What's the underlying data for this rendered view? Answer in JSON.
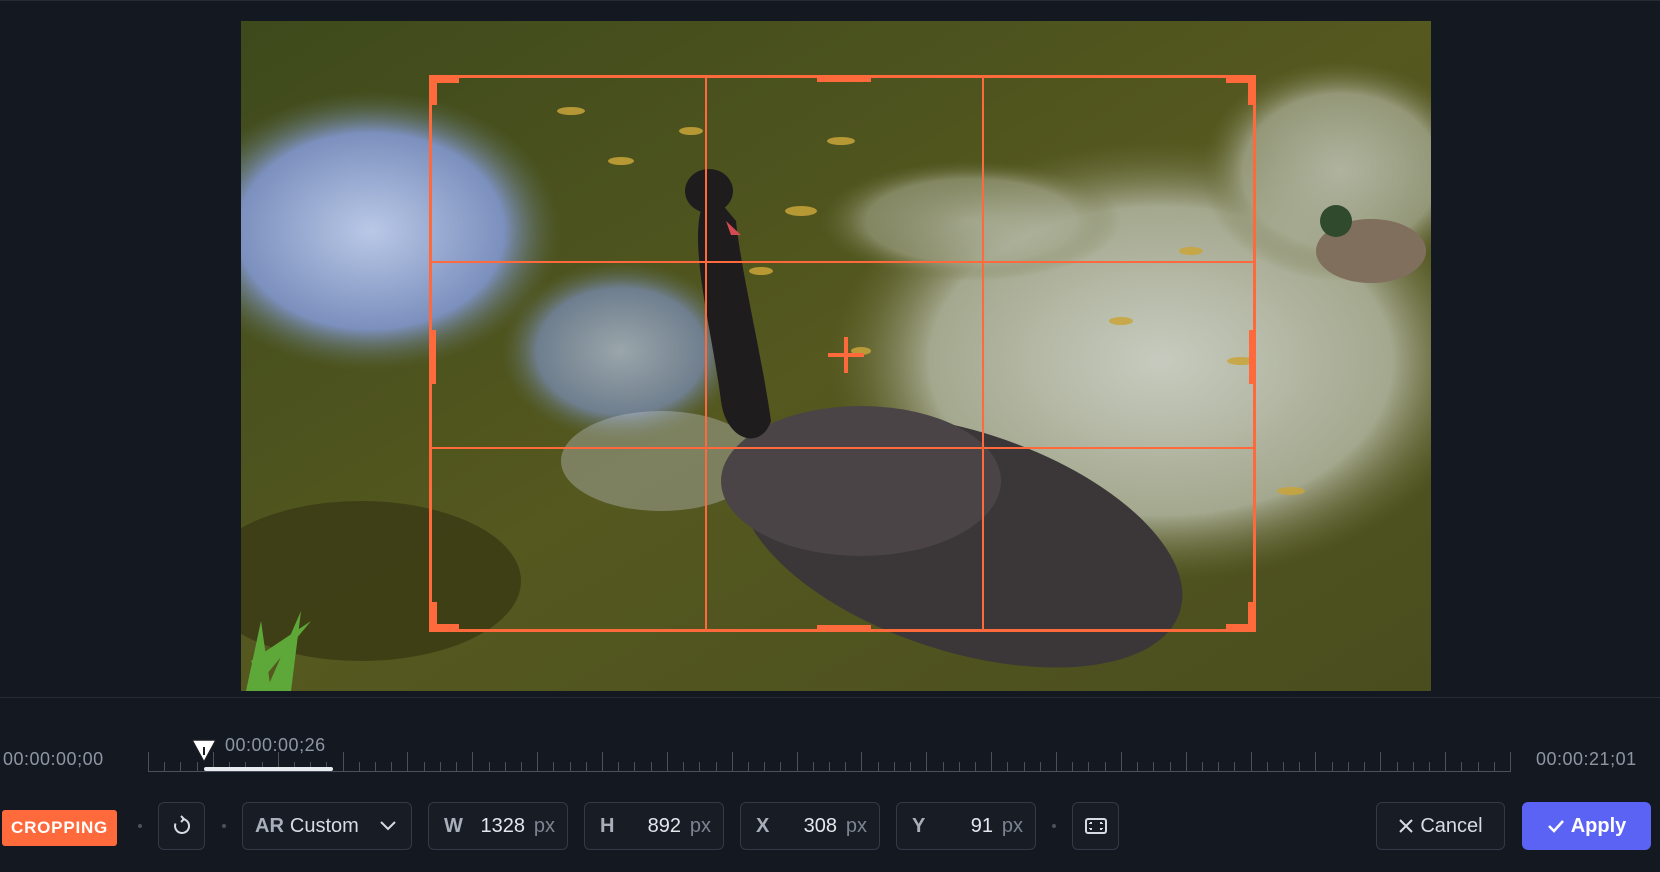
{
  "preview": {
    "image_description_icon": "black-swan-photo-icon"
  },
  "timeline": {
    "start_time": "00:00:00;00",
    "current_time": "00:00:00;26",
    "end_time": "00:00:21;01",
    "progress": 0.042
  },
  "toolbar": {
    "mode_badge": "CROPPING",
    "reset_icon": "reset-rotate-icon",
    "aspect_ratio_key": "AR",
    "aspect_ratio_value": "Custom",
    "width": {
      "key": "W",
      "value": "1328",
      "unit": "px"
    },
    "height": {
      "key": "H",
      "value": "892",
      "unit": "px"
    },
    "x": {
      "key": "X",
      "value": "308",
      "unit": "px"
    },
    "y": {
      "key": "Y",
      "value": "91",
      "unit": "px"
    },
    "fit_icon": "fit-frame-icon",
    "cancel_label": "Cancel",
    "apply_label": "Apply"
  },
  "colors": {
    "accent": "#ff6a3d",
    "apply": "#5b63f5",
    "background": "#141821"
  }
}
